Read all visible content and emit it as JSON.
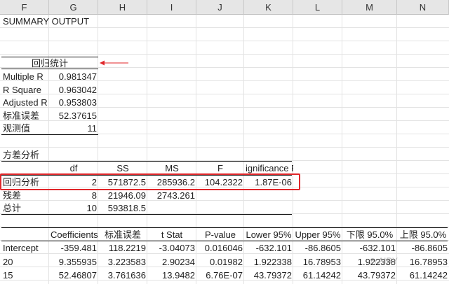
{
  "columns": [
    "F",
    "G",
    "H",
    "I",
    "J",
    "K",
    "L",
    "M",
    "N"
  ],
  "title": "SUMMARY OUTPUT",
  "regression_stats": {
    "header": "回归统计",
    "rows": [
      {
        "label": "Multiple R",
        "value": "0.981347"
      },
      {
        "label": "R Square",
        "value": "0.963042"
      },
      {
        "label": "Adjusted R",
        "value": "0.953803"
      },
      {
        "label": "标准误差",
        "value": "52.37615"
      },
      {
        "label": "观测值",
        "value": "11"
      }
    ]
  },
  "anova": {
    "title": "方差分析",
    "headers": [
      "df",
      "SS",
      "MS",
      "F",
      "ignificance F"
    ],
    "rows": [
      {
        "label": "回归分析",
        "df": "2",
        "ss": "571872.5",
        "ms": "285936.2",
        "f": "104.2322",
        "sig": "1.87E-06"
      },
      {
        "label": "残差",
        "df": "8",
        "ss": "21946.09",
        "ms": "2743.261",
        "f": "",
        "sig": ""
      },
      {
        "label": "总计",
        "df": "10",
        "ss": "593818.5",
        "ms": "",
        "f": "",
        "sig": ""
      }
    ]
  },
  "coefficients": {
    "headers": [
      "Coefficients",
      "标准误差",
      "t Stat",
      "P-value",
      "Lower 95%",
      "Upper 95%",
      "下限 95.0%",
      "上限 95.0%"
    ],
    "rows": [
      {
        "label": "Intercept",
        "values": [
          "-359.481",
          "118.2219",
          "-3.04073",
          "0.016046",
          "-632.101",
          "-86.8605",
          "-632.101",
          "-86.8605"
        ]
      },
      {
        "label": "20",
        "values": [
          "9.355935",
          "3.223583",
          "2.90234",
          "0.01982",
          "1.922338",
          "16.78953",
          "1.922338",
          "16.78953"
        ]
      },
      {
        "label": "15",
        "values": [
          "52.46807",
          "3.761636",
          "13.9482",
          "6.76E-07",
          "43.79372",
          "61.14242",
          "43.79372",
          "61.14242"
        ]
      }
    ]
  },
  "watermark": "AIRY",
  "colors": {
    "highlight": "#e0262a",
    "header_bg": "#e6e6e6"
  }
}
